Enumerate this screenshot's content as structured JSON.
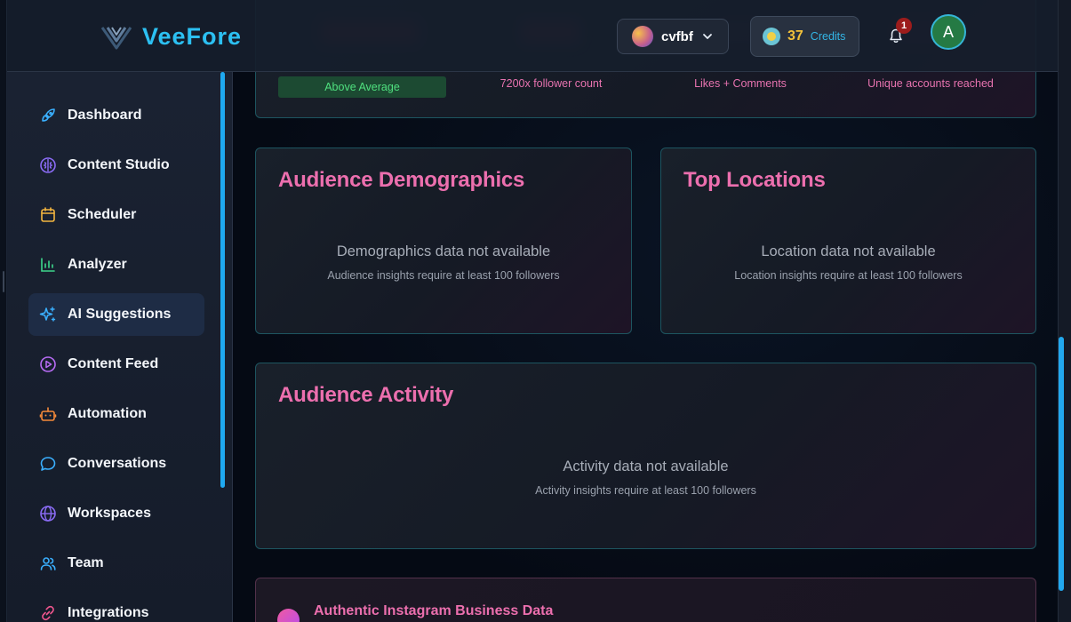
{
  "app": {
    "brand": "VeeFore",
    "workspace": "cvfbf",
    "credits_value": "37",
    "credits_label": "Credits",
    "notification_count": "1",
    "user_initial": "A"
  },
  "sidebar": {
    "items": [
      {
        "label": "Dashboard",
        "icon": "rocket-icon",
        "color": "#3ab0ff"
      },
      {
        "label": "Content Studio",
        "icon": "brain-icon",
        "color": "#8b6cf6"
      },
      {
        "label": "Scheduler",
        "icon": "calendar-icon",
        "color": "#f4b63f"
      },
      {
        "label": "Analyzer",
        "icon": "bar-chart-icon",
        "color": "#3dd68c"
      },
      {
        "label": "AI Suggestions",
        "icon": "sparkles-icon",
        "color": "#3ab0ff",
        "active": true
      },
      {
        "label": "Content Feed",
        "icon": "play-circle-icon",
        "color": "#b86cf6"
      },
      {
        "label": "Automation",
        "icon": "robot-icon",
        "color": "#f58a3a"
      },
      {
        "label": "Conversations",
        "icon": "chat-bubble-icon",
        "color": "#3ab0ff"
      },
      {
        "label": "Workspaces",
        "icon": "globe-icon",
        "color": "#8b6cf6"
      },
      {
        "label": "Team",
        "icon": "users-icon",
        "color": "#3ab0ff"
      },
      {
        "label": "Integrations",
        "icon": "link-icon",
        "color": "#f0568e"
      }
    ]
  },
  "metrics": {
    "badge": "Above Average",
    "subs": [
      "7200x follower count",
      "Likes + Comments",
      "Unique accounts reached"
    ]
  },
  "demographics": {
    "title": "Audience Demographics",
    "empty": "Demographics data not available",
    "note": "Audience insights require at least 100 followers"
  },
  "locations": {
    "title": "Top Locations",
    "empty": "Location data not available",
    "note": "Location insights require at least 100 followers"
  },
  "activity": {
    "title": "Audience Activity",
    "empty": "Activity data not available",
    "note": "Activity insights require at least 100 followers"
  },
  "business": {
    "title": "Authentic Instagram Business Data"
  },
  "colors": {
    "accent_pink": "#ec6fae",
    "accent_cyan": "#2cc0f2",
    "badge_green": "#4fe07f"
  }
}
